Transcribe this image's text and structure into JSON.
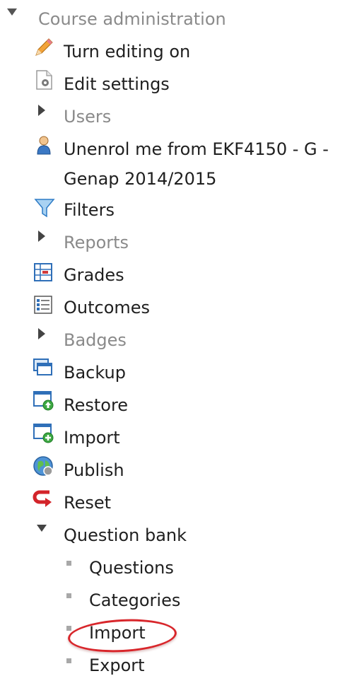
{
  "nav": {
    "course_admin": {
      "label": "Course administration",
      "items": {
        "turn_editing_on": "Turn editing on",
        "edit_settings": "Edit settings",
        "users": "Users",
        "unenrol_line1": "Unenrol me from EKF4150 - G -",
        "unenrol_line2": "Genap 2014/2015",
        "filters": "Filters",
        "reports": "Reports",
        "grades": "Grades",
        "outcomes": "Outcomes",
        "badges": "Badges",
        "backup": "Backup",
        "restore": "Restore",
        "import": "Import",
        "publish": "Publish",
        "reset": "Reset"
      }
    },
    "question_bank": {
      "label": "Question bank",
      "items": {
        "questions": "Questions",
        "categories": "Categories",
        "import": "Import",
        "export": "Export"
      }
    }
  },
  "colors": {
    "highlight": "#d8262b",
    "muted_text": "#8a8a8a",
    "text": "#1f1f1f"
  }
}
